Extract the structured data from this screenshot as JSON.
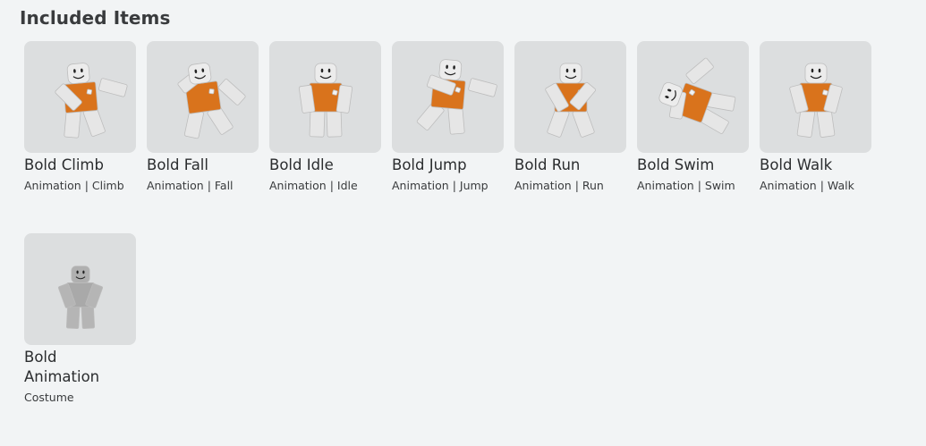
{
  "section": {
    "title": "Included Items"
  },
  "items": [
    {
      "name": "Bold Climb",
      "type": "Animation | Climb",
      "style": "orange",
      "pose": "climb"
    },
    {
      "name": "Bold Fall",
      "type": "Animation | Fall",
      "style": "orange",
      "pose": "fall"
    },
    {
      "name": "Bold Idle",
      "type": "Animation | Idle",
      "style": "orange",
      "pose": "idle"
    },
    {
      "name": "Bold Jump",
      "type": "Animation | Jump",
      "style": "orange",
      "pose": "jump"
    },
    {
      "name": "Bold Run",
      "type": "Animation | Run",
      "style": "orange",
      "pose": "run"
    },
    {
      "name": "Bold Swim",
      "type": "Animation | Swim",
      "style": "orange",
      "pose": "swim"
    },
    {
      "name": "Bold Walk",
      "type": "Animation | Walk",
      "style": "orange",
      "pose": "walk"
    },
    {
      "name": "Bold Animation",
      "type": "Costume",
      "style": "gray",
      "pose": "costume"
    }
  ],
  "colors": {
    "background": "#f2f4f5",
    "thumbnail": "#dcdedf",
    "torso": "#d9731c",
    "limbs": "#e6e6e6",
    "costume": "#a9a9a9"
  }
}
